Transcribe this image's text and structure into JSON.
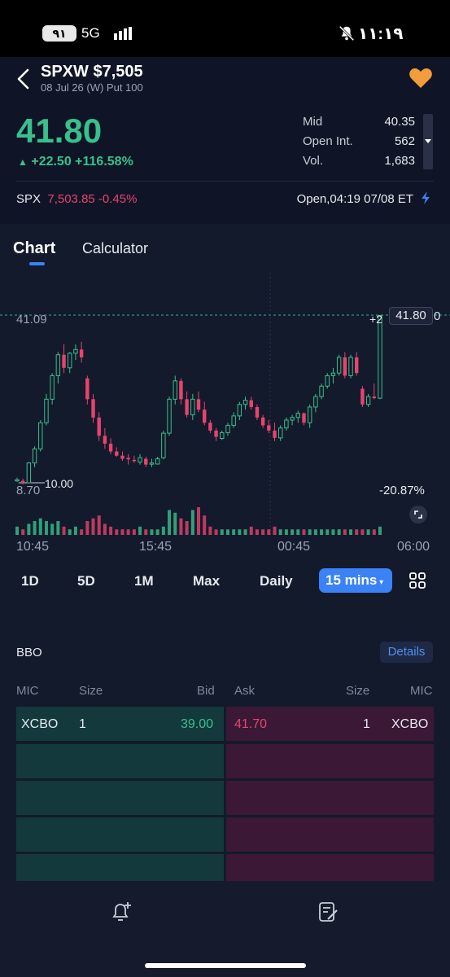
{
  "status_bar": {
    "badge": "٩١",
    "network": "5G",
    "time": "١١:١٩"
  },
  "header": {
    "title": "SPXW $7,505",
    "subtitle": "08 Jul 26 (W) Put 100",
    "last_price": "41.80",
    "change": "+22.50 +116.58%",
    "stats": [
      {
        "label": "Mid",
        "value": "40.35"
      },
      {
        "label": "Open Int.",
        "value": "562"
      },
      {
        "label": "Vol.",
        "value": "1,683"
      }
    ],
    "underlying": {
      "symbol": "SPX",
      "price": "7,503.85",
      "change": "-0.45%"
    },
    "session": "Open,04:19 07/08 ET"
  },
  "tabs": [
    {
      "label": "Chart"
    },
    {
      "label": "Calculator"
    }
  ],
  "chart": {
    "high_label": "41.09",
    "low_label": "8.70",
    "min_marker": "10.00",
    "pct_high": "+2",
    "pct_low": "-20.87%",
    "last_box": "41.80",
    "last_suffix": "0",
    "x_labels": [
      "10:45",
      "15:45",
      "00:45",
      "06:00"
    ]
  },
  "chart_data": {
    "type": "candlestick",
    "interval": "15 mins",
    "ohlc": [
      [
        9.5,
        10.0,
        9.2,
        9.6
      ],
      [
        9.4,
        9.8,
        8.7,
        9.0
      ],
      [
        9.0,
        13.0,
        8.9,
        12.8
      ],
      [
        12.8,
        16.0,
        12.0,
        15.5
      ],
      [
        15.5,
        21.0,
        15.0,
        20.5
      ],
      [
        20.5,
        26.0,
        20.0,
        25.0
      ],
      [
        25.0,
        30.0,
        24.0,
        29.5
      ],
      [
        29.5,
        34.0,
        28.0,
        33.5
      ],
      [
        33.5,
        35.5,
        30.0,
        31.0
      ],
      [
        31.0,
        34.0,
        30.0,
        33.8
      ],
      [
        33.8,
        35.5,
        32.5,
        34.5
      ],
      [
        34.5,
        36.0,
        32.0,
        33.0
      ],
      [
        29.0,
        29.5,
        24.0,
        25.0
      ],
      [
        25.0,
        26.0,
        20.5,
        21.5
      ],
      [
        21.5,
        22.5,
        17.0,
        18.0
      ],
      [
        18.0,
        19.5,
        15.5,
        16.5
      ],
      [
        16.5,
        17.5,
        14.5,
        15.0
      ],
      [
        15.0,
        15.8,
        14.0,
        14.2
      ],
      [
        14.2,
        15.0,
        13.2,
        13.6
      ],
      [
        13.8,
        14.5,
        12.5,
        13.5
      ],
      [
        13.4,
        14.2,
        12.8,
        13.2
      ],
      [
        13.0,
        14.5,
        12.5,
        13.8
      ],
      [
        13.6,
        14.0,
        12.0,
        12.5
      ],
      [
        12.8,
        13.6,
        12.0,
        12.8
      ],
      [
        12.6,
        14.0,
        12.5,
        13.6
      ],
      [
        13.8,
        19.0,
        13.5,
        18.5
      ],
      [
        18.5,
        25.5,
        18.0,
        25.0
      ],
      [
        25.0,
        29.5,
        24.0,
        28.5
      ],
      [
        28.5,
        29.0,
        24.0,
        25.0
      ],
      [
        25.0,
        26.5,
        21.5,
        22.0
      ],
      [
        22.0,
        26.0,
        21.0,
        25.0
      ],
      [
        25.0,
        26.5,
        22.5,
        23.0
      ],
      [
        23.0,
        24.5,
        20.0,
        20.5
      ],
      [
        20.5,
        21.0,
        18.5,
        19.0
      ],
      [
        19.0,
        19.5,
        17.0,
        17.8
      ],
      [
        17.5,
        19.0,
        17.2,
        18.6
      ],
      [
        18.6,
        20.5,
        18.0,
        20.0
      ],
      [
        20.0,
        22.5,
        19.5,
        21.8
      ],
      [
        21.8,
        24.5,
        21.0,
        24.0
      ],
      [
        24.0,
        25.5,
        23.0,
        24.8
      ],
      [
        24.8,
        25.5,
        23.0,
        23.5
      ],
      [
        23.5,
        24.0,
        21.0,
        21.5
      ],
      [
        21.5,
        22.0,
        19.5,
        20.0
      ],
      [
        20.0,
        21.0,
        18.5,
        19.0
      ],
      [
        19.0,
        20.5,
        17.0,
        17.6
      ],
      [
        17.6,
        20.0,
        17.0,
        19.5
      ],
      [
        19.5,
        21.5,
        19.0,
        21.0
      ],
      [
        21.0,
        22.0,
        20.0,
        21.5
      ],
      [
        21.5,
        22.8,
        20.5,
        22.3
      ],
      [
        22.3,
        22.5,
        20.0,
        20.5
      ],
      [
        20.5,
        24.0,
        19.5,
        23.5
      ],
      [
        23.5,
        26.0,
        22.5,
        25.5
      ],
      [
        25.5,
        28.0,
        25.0,
        27.5
      ],
      [
        27.5,
        30.0,
        27.0,
        29.5
      ],
      [
        29.5,
        31.0,
        28.0,
        30.0
      ],
      [
        30.0,
        33.5,
        29.5,
        33.0
      ],
      [
        33.0,
        34.0,
        29.0,
        29.5
      ],
      [
        29.5,
        33.5,
        29.0,
        33.0
      ],
      [
        33.0,
        34.0,
        29.5,
        30.0
      ],
      [
        27.0,
        27.5,
        23.5,
        24.0
      ],
      [
        24.0,
        26.0,
        23.5,
        25.5
      ],
      [
        25.5,
        28.0,
        25.0,
        25.2
      ],
      [
        25.2,
        41.09,
        25.0,
        41.0
      ]
    ],
    "volume": [
      3,
      2,
      4,
      5,
      6,
      5,
      4,
      5,
      3,
      2,
      3,
      2,
      5,
      6,
      7,
      4,
      3,
      2,
      2,
      2,
      2,
      3,
      2,
      2,
      2,
      3,
      9,
      8,
      6,
      5,
      9,
      10,
      7,
      3,
      2,
      2,
      2,
      2,
      2,
      2,
      3,
      2,
      2,
      2,
      3,
      2,
      2,
      2,
      2,
      2,
      2,
      2,
      2,
      2,
      2,
      2,
      2,
      2,
      2,
      2,
      2,
      2,
      3
    ]
  },
  "ranges": [
    {
      "label": "1D"
    },
    {
      "label": "5D"
    },
    {
      "label": "1M"
    },
    {
      "label": "Max"
    },
    {
      "label": "Daily"
    }
  ],
  "active_range": "15 mins",
  "bbo": {
    "title": "BBO",
    "details_label": "Details",
    "columns": {
      "mic_left": "MIC",
      "size_left": "Size",
      "bid": "Bid",
      "ask": "Ask",
      "size_right": "Size",
      "mic_right": "MIC"
    },
    "quote": {
      "bid_mic": "XCBO",
      "bid_size": "1",
      "bid": "39.00",
      "ask": "41.70",
      "ask_size": "1",
      "ask_mic": "XCBO"
    }
  },
  "colors": {
    "up": "#39c08c",
    "down": "#e8436e",
    "accent": "#3b82f6",
    "bg": "#131a2c"
  }
}
